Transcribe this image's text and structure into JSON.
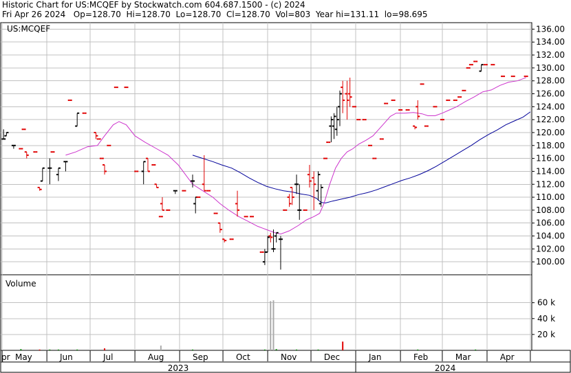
{
  "header": {
    "line1": "Historic Chart for US:MCQEF by Stockwatch.com 604.687.1500 - (c) 2024",
    "line2": "Fri Apr 26 2024   Op=128.70  Hi=128.70  Lo=128.70  Cl=128.70  Vol=803  Year hi=131.11  lo=98.695"
  },
  "chart_data": {
    "type": "ohlc",
    "symbol_label": "US:MCQEF",
    "volume_label": "Volume",
    "colors": {
      "up": "#000000",
      "down": "#e00000",
      "ma_fast": "#cc33cc",
      "ma_slow": "#000099",
      "volume": "#aaaaaa",
      "vol_down": "#e00000",
      "vol_up": "#008800",
      "grid": "#c0c0c0"
    },
    "price_axis": {
      "min": 98,
      "max": 137,
      "ticks": [
        100,
        102,
        104,
        106,
        108,
        110,
        112,
        114,
        116,
        118,
        120,
        122,
        124,
        126,
        128,
        130,
        132,
        134,
        136
      ]
    },
    "price_tick_labels": [
      "100.00",
      "102.00",
      "104.00",
      "106.00",
      "108.00",
      "110.00",
      "112.00",
      "114.00",
      "116.00",
      "118.00",
      "120.00",
      "122.00",
      "124.00",
      "126.00",
      "128.00",
      "130.00",
      "132.00",
      "134.00",
      "136.00"
    ],
    "volume_axis": {
      "min": 0,
      "max": 90,
      "ticks": [
        20,
        40,
        60
      ],
      "tick_labels": [
        "20 k",
        "40 k",
        "60 k"
      ]
    },
    "month_labels": [
      {
        "label": "pr",
        "day": -5
      },
      {
        "label": "May",
        "day": 10
      },
      {
        "label": "Jun",
        "day": 41
      },
      {
        "label": "Jul",
        "day": 71
      },
      {
        "label": "Aug",
        "day": 102
      },
      {
        "label": "Sep",
        "day": 133
      },
      {
        "label": "Oct",
        "day": 163
      },
      {
        "label": "Nov",
        "day": 194
      },
      {
        "label": "Dec",
        "day": 224
      },
      {
        "label": "Jan",
        "day": 255
      },
      {
        "label": "Feb",
        "day": 286
      },
      {
        "label": "Mar",
        "day": 315
      },
      {
        "label": "Apr",
        "day": 346
      }
    ],
    "month_ticks": [
      1,
      32,
      62,
      93,
      124,
      154,
      185,
      215,
      246,
      277,
      306,
      337,
      367
    ],
    "year_labels": [
      {
        "label": "2023",
        "day": 123
      },
      {
        "label": "2024",
        "day": 308
      }
    ],
    "year_divider_day": 246,
    "day_range": [
      0,
      368
    ],
    "bars": [
      {
        "d": 2,
        "o": 119,
        "h": 120.5,
        "l": 119,
        "c": 119
      },
      {
        "d": 4,
        "o": 119.5,
        "h": 120,
        "l": 119.5,
        "c": 120
      },
      {
        "d": 9,
        "o": 118,
        "h": 118,
        "l": 117.5,
        "c": 118
      },
      {
        "d": 14,
        "o": 117.5,
        "h": 117.5,
        "l": 117.5,
        "c": 117.5
      },
      {
        "d": 16,
        "o": 120.5,
        "h": 120.5,
        "l": 120.5,
        "c": 120.5
      },
      {
        "d": 18,
        "o": 117,
        "h": 117,
        "l": 116,
        "c": 116.5
      },
      {
        "d": 24,
        "o": 117,
        "h": 117,
        "l": 117,
        "c": 117
      },
      {
        "d": 27,
        "o": 111.5,
        "h": 111.5,
        "l": 111,
        "c": 111.2
      },
      {
        "d": 29,
        "o": 112.5,
        "h": 114.5,
        "l": 112.5,
        "c": 114.5
      },
      {
        "d": 34,
        "o": 114.5,
        "h": 116,
        "l": 112,
        "c": 114.5
      },
      {
        "d": 36,
        "o": 117,
        "h": 117,
        "l": 117,
        "c": 117
      },
      {
        "d": 40,
        "o": 113.5,
        "h": 114.5,
        "l": 112.5,
        "c": 114.5
      },
      {
        "d": 45,
        "o": 115.5,
        "h": 115.5,
        "l": 114,
        "c": 115.5
      },
      {
        "d": 48,
        "o": 125,
        "h": 125,
        "l": 125,
        "c": 125
      },
      {
        "d": 53,
        "o": 121,
        "h": 123,
        "l": 121,
        "c": 123
      },
      {
        "d": 58,
        "o": 123,
        "h": 123,
        "l": 123,
        "c": 123
      },
      {
        "d": 66,
        "o": 120,
        "h": 120,
        "l": 119,
        "c": 119.5
      },
      {
        "d": 68,
        "o": 119,
        "h": 119,
        "l": 119,
        "c": 119
      },
      {
        "d": 70,
        "o": 116,
        "h": 116,
        "l": 116,
        "c": 116
      },
      {
        "d": 72,
        "o": 115,
        "h": 115,
        "l": 113.5,
        "c": 114
      },
      {
        "d": 75,
        "o": 118,
        "h": 118,
        "l": 118,
        "c": 118
      },
      {
        "d": 80,
        "o": 127,
        "h": 127,
        "l": 127,
        "c": 127
      },
      {
        "d": 87,
        "o": 127,
        "h": 127,
        "l": 127,
        "c": 127
      },
      {
        "d": 94,
        "o": 114,
        "h": 114,
        "l": 114,
        "c": 114
      },
      {
        "d": 99,
        "o": 114,
        "h": 115.5,
        "l": 112,
        "c": 115.5
      },
      {
        "d": 102,
        "o": 116,
        "h": 116,
        "l": 114,
        "c": 114
      },
      {
        "d": 106,
        "o": 115,
        "h": 115,
        "l": 115,
        "c": 115
      },
      {
        "d": 108,
        "o": 112,
        "h": 112,
        "l": 111.5,
        "c": 111.5
      },
      {
        "d": 111,
        "o": 107,
        "h": 107,
        "l": 107,
        "c": 107
      },
      {
        "d": 112,
        "o": 109,
        "h": 110,
        "l": 108,
        "c": 108
      },
      {
        "d": 116,
        "o": 108,
        "h": 108,
        "l": 108,
        "c": 108
      },
      {
        "d": 121,
        "o": 111,
        "h": 111,
        "l": 110.5,
        "c": 111
      },
      {
        "d": 127,
        "o": 111,
        "h": 111,
        "l": 111,
        "c": 111
      },
      {
        "d": 133,
        "o": 112.5,
        "h": 113.5,
        "l": 111.5,
        "c": 112.5
      },
      {
        "d": 135,
        "o": 109,
        "h": 110,
        "l": 107.5,
        "c": 110
      },
      {
        "d": 137,
        "o": 110,
        "h": 110,
        "l": 110,
        "c": 110
      },
      {
        "d": 141,
        "o": 112,
        "h": 116.5,
        "l": 111,
        "c": 111
      },
      {
        "d": 144,
        "o": 111,
        "h": 111,
        "l": 111,
        "c": 111
      },
      {
        "d": 149,
        "o": 107.5,
        "h": 107.5,
        "l": 107.5,
        "c": 107.5
      },
      {
        "d": 152,
        "o": 106,
        "h": 106,
        "l": 104.5,
        "c": 105
      },
      {
        "d": 155,
        "o": 103.5,
        "h": 103.5,
        "l": 103,
        "c": 103.3
      },
      {
        "d": 160,
        "o": 103.5,
        "h": 103.5,
        "l": 103.5,
        "c": 103.5
      },
      {
        "d": 164,
        "o": 109,
        "h": 111,
        "l": 107,
        "c": 108
      },
      {
        "d": 170,
        "o": 107,
        "h": 107,
        "l": 107,
        "c": 107
      },
      {
        "d": 174,
        "o": 107,
        "h": 107,
        "l": 107,
        "c": 107
      },
      {
        "d": 181,
        "o": 101.5,
        "h": 101.5,
        "l": 101.5,
        "c": 101.5
      },
      {
        "d": 183,
        "o": 100,
        "h": 102,
        "l": 99.5,
        "c": 101.5
      },
      {
        "d": 185,
        "o": 101.5,
        "h": 104,
        "l": 101.5,
        "c": 103.8
      },
      {
        "d": 187,
        "o": 104,
        "h": 104.5,
        "l": 103,
        "c": 103.8
      },
      {
        "d": 189,
        "o": 102,
        "h": 105,
        "l": 101.5,
        "c": 102
      },
      {
        "d": 191,
        "o": 104,
        "h": 104.5,
        "l": 103,
        "c": 104.5
      },
      {
        "d": 194,
        "o": 103.5,
        "h": 104,
        "l": 98.8,
        "c": 103.5
      },
      {
        "d": 197,
        "o": 108,
        "h": 108,
        "l": 108,
        "c": 108
      },
      {
        "d": 200,
        "o": 110,
        "h": 110.5,
        "l": 108.5,
        "c": 109
      },
      {
        "d": 202,
        "o": 111.5,
        "h": 111.5,
        "l": 108.8,
        "c": 110
      },
      {
        "d": 205,
        "o": 112,
        "h": 113.5,
        "l": 110.5,
        "c": 112
      },
      {
        "d": 207,
        "o": 108,
        "h": 112,
        "l": 106.5,
        "c": 108
      },
      {
        "d": 211,
        "o": 108,
        "h": 108,
        "l": 108,
        "c": 108
      },
      {
        "d": 214,
        "o": 113.5,
        "h": 115,
        "l": 111.5,
        "c": 112.5
      },
      {
        "d": 217,
        "o": 113,
        "h": 114,
        "l": 108,
        "c": 112
      },
      {
        "d": 220,
        "o": 111,
        "h": 114,
        "l": 109.5,
        "c": 113.5
      },
      {
        "d": 222,
        "o": 109,
        "h": 112,
        "l": 108.5,
        "c": 111.5
      },
      {
        "d": 225,
        "o": 116,
        "h": 116,
        "l": 116,
        "c": 116
      },
      {
        "d": 227,
        "o": 118.5,
        "h": 118.5,
        "l": 118.5,
        "c": 118.5
      },
      {
        "d": 229,
        "o": 121,
        "h": 122.5,
        "l": 118.5,
        "c": 122
      },
      {
        "d": 231,
        "o": 121,
        "h": 123,
        "l": 119,
        "c": 122.5
      },
      {
        "d": 233,
        "o": 120.5,
        "h": 124,
        "l": 119.5,
        "c": 122
      },
      {
        "d": 235,
        "o": 124,
        "h": 126.5,
        "l": 121,
        "c": 126
      },
      {
        "d": 237,
        "o": 127,
        "h": 128,
        "l": 123,
        "c": 125
      },
      {
        "d": 240,
        "o": 126,
        "h": 128,
        "l": 122,
        "c": 125
      },
      {
        "d": 242,
        "o": 126,
        "h": 128.5,
        "l": 124,
        "c": 125.5
      },
      {
        "d": 245,
        "o": 124,
        "h": 124,
        "l": 124,
        "c": 124
      },
      {
        "d": 248,
        "o": 122,
        "h": 122,
        "l": 122,
        "c": 122
      },
      {
        "d": 252,
        "o": 122,
        "h": 122,
        "l": 122,
        "c": 122
      },
      {
        "d": 256,
        "o": 118,
        "h": 118,
        "l": 118,
        "c": 118
      },
      {
        "d": 259,
        "o": 116,
        "h": 116,
        "l": 116,
        "c": 116
      },
      {
        "d": 264,
        "o": 119,
        "h": 119,
        "l": 119,
        "c": 119
      },
      {
        "d": 267,
        "o": 124.5,
        "h": 124.5,
        "l": 124.5,
        "c": 124.5
      },
      {
        "d": 272,
        "o": 125,
        "h": 125,
        "l": 125,
        "c": 125
      },
      {
        "d": 277,
        "o": 123.5,
        "h": 123.5,
        "l": 123.5,
        "c": 123.5
      },
      {
        "d": 282,
        "o": 123.5,
        "h": 123.5,
        "l": 123.5,
        "c": 123.5
      },
      {
        "d": 287,
        "o": 121,
        "h": 121,
        "l": 120.5,
        "c": 120.8
      },
      {
        "d": 289,
        "o": 124,
        "h": 125,
        "l": 122,
        "c": 122.5
      },
      {
        "d": 292,
        "o": 127.5,
        "h": 127.5,
        "l": 127.5,
        "c": 127.5
      },
      {
        "d": 295,
        "o": 121,
        "h": 121,
        "l": 121,
        "c": 121
      },
      {
        "d": 301,
        "o": 124,
        "h": 124,
        "l": 124,
        "c": 124
      },
      {
        "d": 306,
        "o": 122,
        "h": 122,
        "l": 122,
        "c": 122
      },
      {
        "d": 310,
        "o": 125,
        "h": 125,
        "l": 125,
        "c": 125
      },
      {
        "d": 315,
        "o": 125,
        "h": 125,
        "l": 125,
        "c": 125
      },
      {
        "d": 318,
        "o": 125.5,
        "h": 125.5,
        "l": 125.5,
        "c": 125.5
      },
      {
        "d": 321,
        "o": 126.5,
        "h": 126.5,
        "l": 126.5,
        "c": 126.5
      },
      {
        "d": 324,
        "o": 130,
        "h": 130,
        "l": 130,
        "c": 130
      },
      {
        "d": 326,
        "o": 130.5,
        "h": 130.5,
        "l": 130.5,
        "c": 130.5
      },
      {
        "d": 329,
        "o": 131,
        "h": 131,
        "l": 131,
        "c": 131
      },
      {
        "d": 333,
        "o": 129.5,
        "h": 130.5,
        "l": 129.5,
        "c": 130.5
      },
      {
        "d": 336,
        "o": 130.5,
        "h": 130.5,
        "l": 130.5,
        "c": 130.5
      },
      {
        "d": 341,
        "o": 130.5,
        "h": 130.5,
        "l": 130.5,
        "c": 130.5
      },
      {
        "d": 348,
        "o": 128.7,
        "h": 128.7,
        "l": 128.7,
        "c": 128.7
      },
      {
        "d": 355,
        "o": 128.7,
        "h": 128.7,
        "l": 128.7,
        "c": 128.7
      },
      {
        "d": 364,
        "o": 128.7,
        "h": 128.7,
        "l": 128.7,
        "c": 128.7
      }
    ],
    "ma_fast": [
      [
        45,
        116.5
      ],
      [
        52,
        117
      ],
      [
        60,
        117.8
      ],
      [
        67,
        118
      ],
      [
        72,
        119.5
      ],
      [
        78,
        121.2
      ],
      [
        82,
        121.7
      ],
      [
        87,
        121.2
      ],
      [
        93,
        119.5
      ],
      [
        100,
        118.5
      ],
      [
        108,
        117.5
      ],
      [
        116,
        116.5
      ],
      [
        123,
        115
      ],
      [
        128,
        113.5
      ],
      [
        133,
        112
      ],
      [
        140,
        111
      ],
      [
        147,
        110
      ],
      [
        152,
        109
      ],
      [
        158,
        108
      ],
      [
        165,
        107
      ],
      [
        172,
        106.2
      ],
      [
        178,
        105.5
      ],
      [
        184,
        105
      ],
      [
        190,
        104.5
      ],
      [
        194,
        104.3
      ],
      [
        200,
        104.8
      ],
      [
        206,
        105.6
      ],
      [
        212,
        106.5
      ],
      [
        217,
        107
      ],
      [
        221,
        107.5
      ],
      [
        224,
        109
      ],
      [
        228,
        112
      ],
      [
        232,
        114.5
      ],
      [
        236,
        116
      ],
      [
        240,
        117
      ],
      [
        244,
        117.5
      ],
      [
        248,
        118.2
      ],
      [
        253,
        118.8
      ],
      [
        258,
        119.5
      ],
      [
        262,
        120.5
      ],
      [
        266,
        121.5
      ],
      [
        270,
        122.5
      ],
      [
        274,
        123
      ],
      [
        280,
        123
      ],
      [
        286,
        123.1
      ],
      [
        292,
        122.9
      ],
      [
        296,
        122.6
      ],
      [
        301,
        122.6
      ],
      [
        306,
        123
      ],
      [
        311,
        123.5
      ],
      [
        316,
        124
      ],
      [
        322,
        124.8
      ],
      [
        328,
        125.5
      ],
      [
        334,
        126.3
      ],
      [
        340,
        126.6
      ],
      [
        346,
        127.3
      ],
      [
        352,
        127.8
      ],
      [
        358,
        128
      ],
      [
        364,
        128.5
      ]
    ],
    "ma_slow": [
      [
        133,
        116.5
      ],
      [
        140,
        116
      ],
      [
        147,
        115.5
      ],
      [
        153,
        115
      ],
      [
        160,
        114.5
      ],
      [
        166,
        113.8
      ],
      [
        172,
        113
      ],
      [
        178,
        112.3
      ],
      [
        184,
        111.7
      ],
      [
        190,
        111.3
      ],
      [
        196,
        111
      ],
      [
        202,
        110.8
      ],
      [
        208,
        110.5
      ],
      [
        214,
        110.3
      ],
      [
        219,
        109.8
      ],
      [
        222,
        109.2
      ],
      [
        225,
        109.1
      ],
      [
        230,
        109.4
      ],
      [
        236,
        109.7
      ],
      [
        242,
        110
      ],
      [
        248,
        110.4
      ],
      [
        254,
        110.7
      ],
      [
        260,
        111.1
      ],
      [
        266,
        111.6
      ],
      [
        272,
        112.1
      ],
      [
        278,
        112.6
      ],
      [
        284,
        113
      ],
      [
        290,
        113.5
      ],
      [
        296,
        114.1
      ],
      [
        302,
        114.8
      ],
      [
        308,
        115.6
      ],
      [
        314,
        116.4
      ],
      [
        320,
        117.2
      ],
      [
        326,
        118
      ],
      [
        332,
        118.9
      ],
      [
        338,
        119.7
      ],
      [
        344,
        120.4
      ],
      [
        350,
        121.2
      ],
      [
        356,
        121.8
      ],
      [
        362,
        122.4
      ],
      [
        367,
        123.2
      ]
    ],
    "volume": [
      {
        "d": 14,
        "v": 1.5,
        "t": "up"
      },
      {
        "d": 27,
        "v": 1,
        "t": "down"
      },
      {
        "d": 34,
        "v": 1,
        "t": "up"
      },
      {
        "d": 40,
        "v": 1,
        "t": "up"
      },
      {
        "d": 53,
        "v": 1,
        "t": "up"
      },
      {
        "d": 72,
        "v": 2.5,
        "t": "down"
      },
      {
        "d": 111,
        "v": 6,
        "t": "vol"
      },
      {
        "d": 133,
        "v": 1,
        "t": "up"
      },
      {
        "d": 183,
        "v": 1,
        "t": "up"
      },
      {
        "d": 187,
        "v": 62,
        "t": "vol"
      },
      {
        "d": 189,
        "v": 63,
        "t": "vol"
      },
      {
        "d": 191,
        "v": 1.5,
        "t": "up"
      },
      {
        "d": 205,
        "v": 1,
        "t": "up"
      },
      {
        "d": 220,
        "v": 1,
        "t": "up"
      },
      {
        "d": 237,
        "v": 11,
        "t": "down"
      },
      {
        "d": 289,
        "v": 1,
        "t": "up"
      },
      {
        "d": 329,
        "v": 1,
        "t": "up"
      }
    ]
  }
}
